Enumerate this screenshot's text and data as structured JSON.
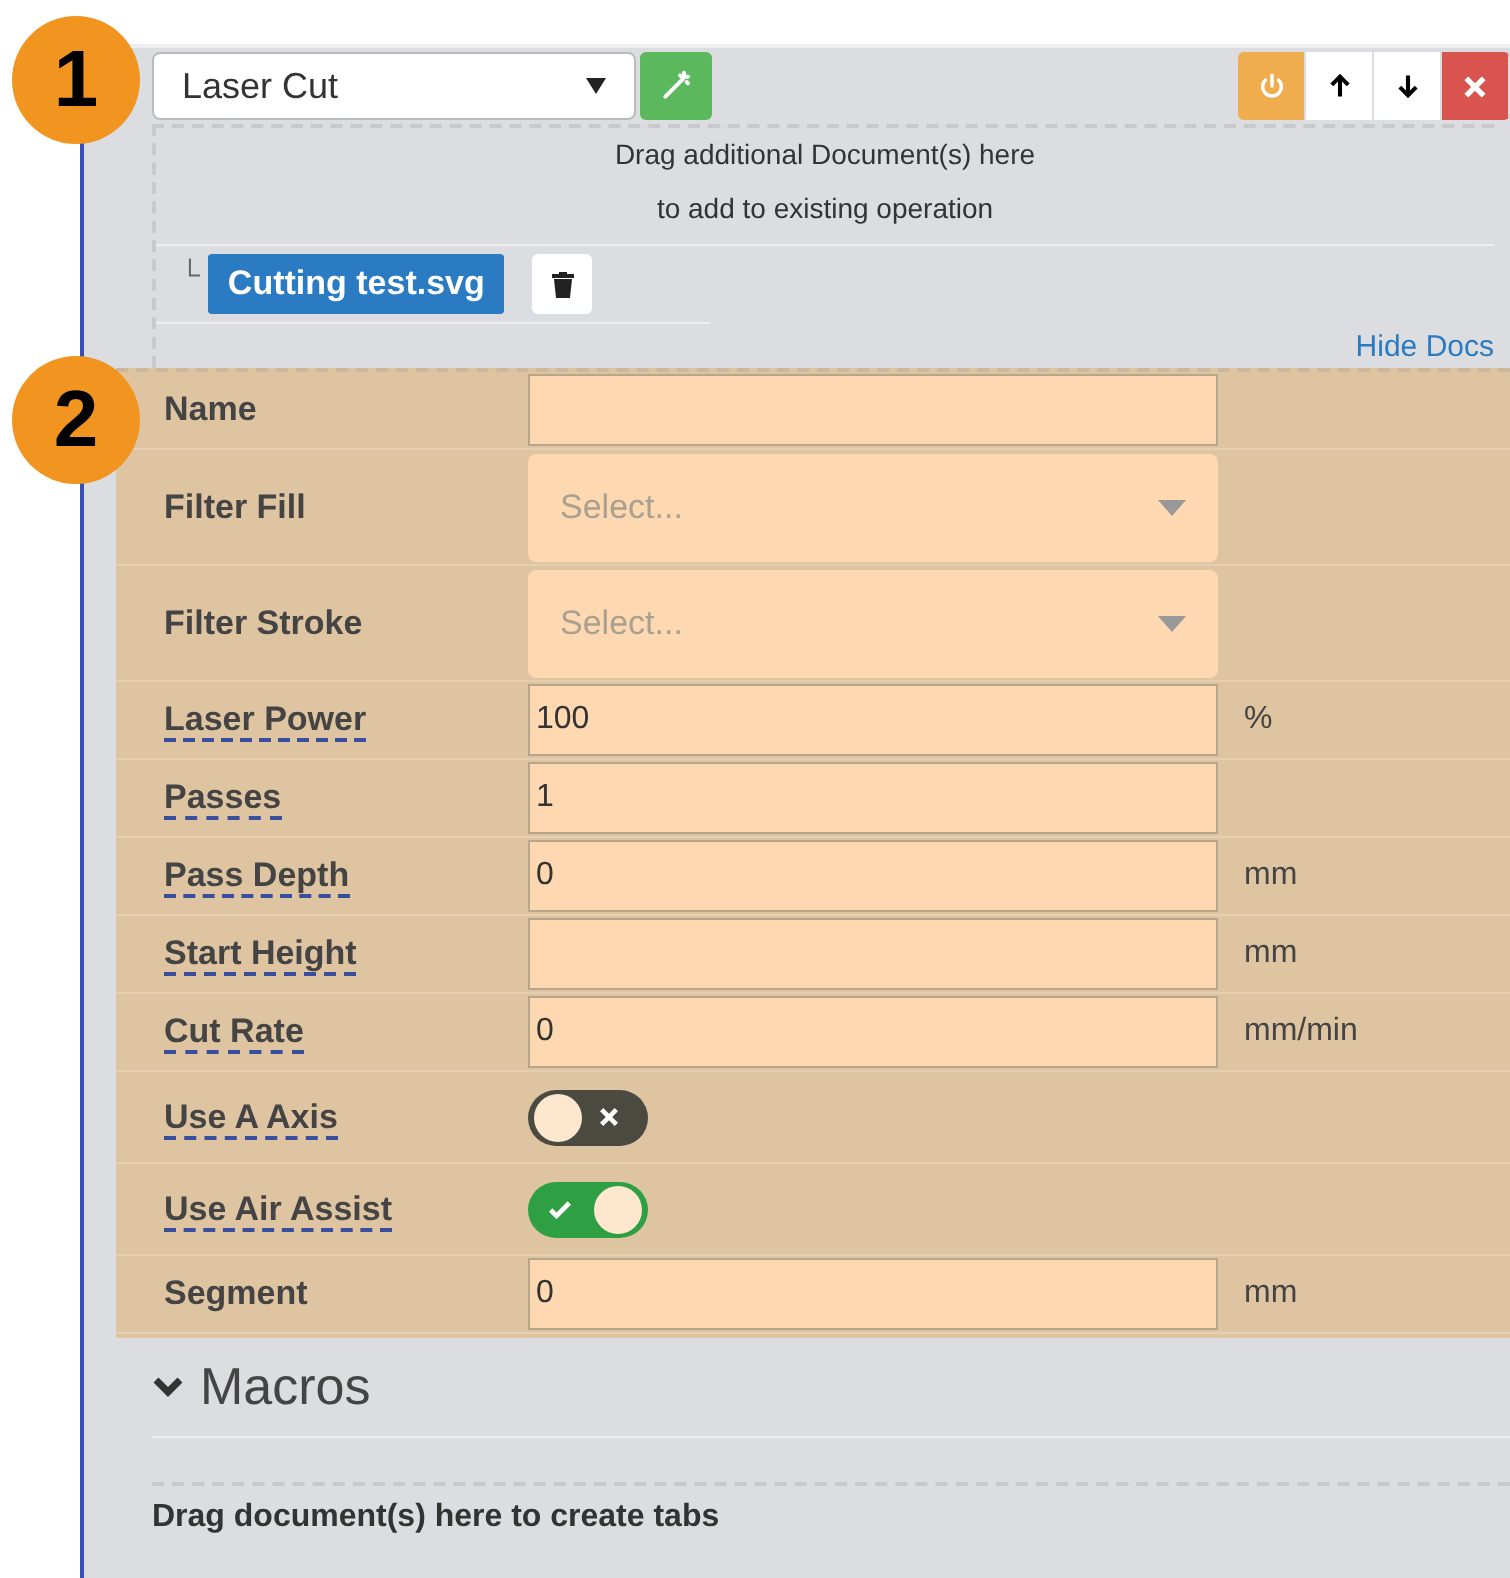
{
  "callouts": [
    "1",
    "2"
  ],
  "operation": {
    "type": "Laser Cut",
    "action_buttons": [
      {
        "kind": "power"
      },
      {
        "kind": "up"
      },
      {
        "kind": "down"
      },
      {
        "kind": "remove"
      }
    ]
  },
  "drop_zone": [
    "Drag additional Document(s) here",
    "to add to existing operation"
  ],
  "documents": [
    {
      "tree_mark": "└",
      "name": "Cutting test.svg"
    }
  ],
  "hide_docs": "Hide Docs",
  "fields": [
    {
      "kind": "text",
      "label": "Name",
      "help": false
    },
    {
      "kind": "select",
      "label": "Filter Fill",
      "help": false,
      "placeholder": "Select..."
    },
    {
      "kind": "select",
      "label": "Filter Stroke",
      "help": false,
      "placeholder": "Select..."
    },
    {
      "kind": "text",
      "label": "Laser Power",
      "help": true,
      "value": "100",
      "unit": "%"
    },
    {
      "kind": "text",
      "label": "Passes",
      "help": true,
      "value": "1"
    },
    {
      "kind": "text",
      "label": "Pass Depth",
      "help": true,
      "value": "0",
      "unit": "mm"
    },
    {
      "kind": "text",
      "label": "Start Height",
      "help": true,
      "unit": "mm"
    },
    {
      "kind": "text",
      "label": "Cut Rate",
      "help": true,
      "value": "0",
      "unit": "mm/min"
    },
    {
      "kind": "toggle",
      "label": "Use A Axis",
      "help": true,
      "on": false
    },
    {
      "kind": "toggle",
      "label": "Use Air Assist",
      "help": true,
      "on": true
    },
    {
      "kind": "text",
      "label": "Segment",
      "help": false,
      "value": "0",
      "unit": "mm"
    }
  ],
  "macros": {
    "label": "Macros"
  },
  "footer_drop": "Drag document(s) here to create tabs"
}
